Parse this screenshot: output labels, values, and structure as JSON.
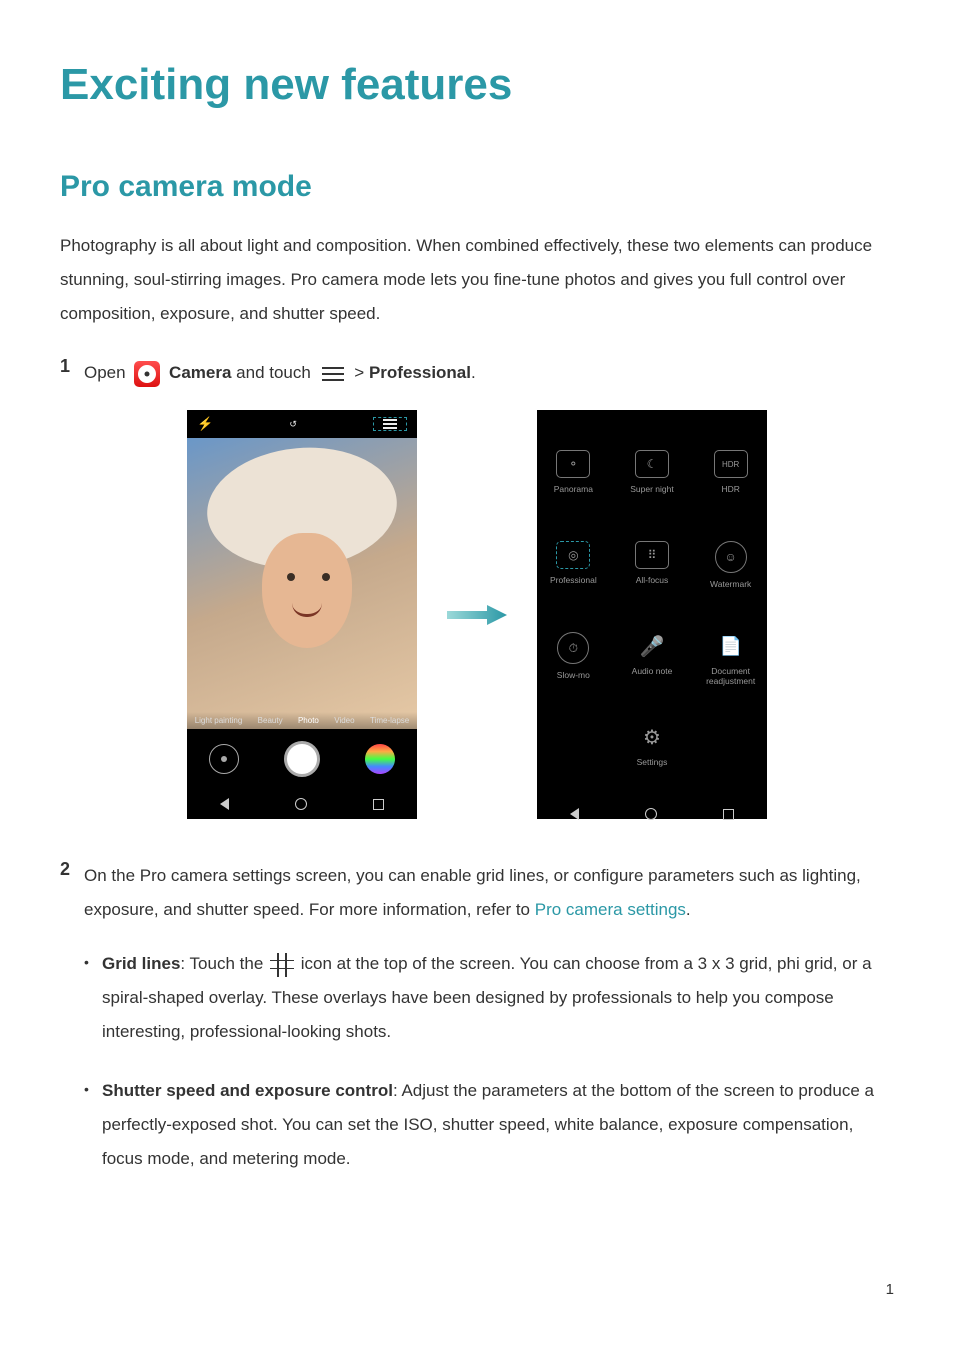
{
  "page": {
    "title": "Exciting new features",
    "section_title": "Pro camera mode",
    "intro": "Photography is all about light and composition. When combined effectively, these two elements can produce stunning, soul-stirring images. Pro camera mode lets you fine-tune photos and gives you full control over composition, exposure, and shutter speed.",
    "page_number": "1"
  },
  "step1": {
    "num": "1",
    "open_text": "Open ",
    "camera_label": "Camera",
    "and_touch": " and touch ",
    "gt": " > ",
    "professional": "Professional",
    "period": "."
  },
  "left_phone": {
    "modes": [
      "Light painting",
      "Beauty",
      "Photo",
      "Video",
      "Time-lapse"
    ]
  },
  "right_phone": {
    "items": [
      {
        "label": "Panorama"
      },
      {
        "label": "Super night"
      },
      {
        "label": "HDR"
      },
      {
        "label": "Professional"
      },
      {
        "label": "All-focus"
      },
      {
        "label": "Watermark"
      },
      {
        "label": "Slow-mo"
      },
      {
        "label": "Audio note"
      },
      {
        "label": "Document readjustment"
      },
      {
        "label": "Settings"
      }
    ]
  },
  "step2": {
    "num": "2",
    "text_a": "On the Pro camera settings screen, you can enable grid lines, or configure parameters such as lighting, exposure, and shutter speed. For more information, refer to ",
    "link": "Pro camera settings",
    "period": "."
  },
  "bullet1": {
    "label": "Grid lines",
    "before_icon": ": Touch the ",
    "after_icon": " icon at the top of the screen. You can choose from a 3 x 3 grid, phi grid, or a spiral-shaped overlay. These overlays have been designed by professionals to help you compose interesting, professional-looking shots."
  },
  "bullet2": {
    "label": "Shutter speed and exposure control",
    "text": ": Adjust the parameters at the bottom of the screen to produce a perfectly-exposed shot. You can set the ISO, shutter speed, white balance, exposure compensation, focus mode, and metering mode."
  },
  "colors": {
    "accent": "#2b98a6"
  }
}
